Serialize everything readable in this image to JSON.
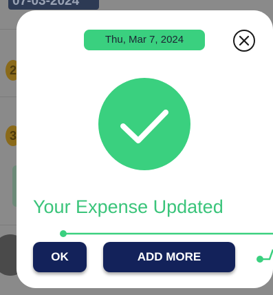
{
  "background": {
    "date_label": "07-03-2024",
    "row_coins": [
      "2",
      "3"
    ]
  },
  "modal": {
    "date_badge": "Thu, Mar 7, 2024",
    "close_icon": "close-circle-x-icon",
    "success_icon": "checkmark-icon",
    "headline": "Your Expense Updated",
    "ok_label": "OK",
    "add_more_label": "ADD MORE"
  },
  "colors": {
    "accent_green": "#3ad07f",
    "button_navy": "#13225a",
    "headline_green": "#3ac47a",
    "overlay_gray": "#8a8a8a"
  }
}
